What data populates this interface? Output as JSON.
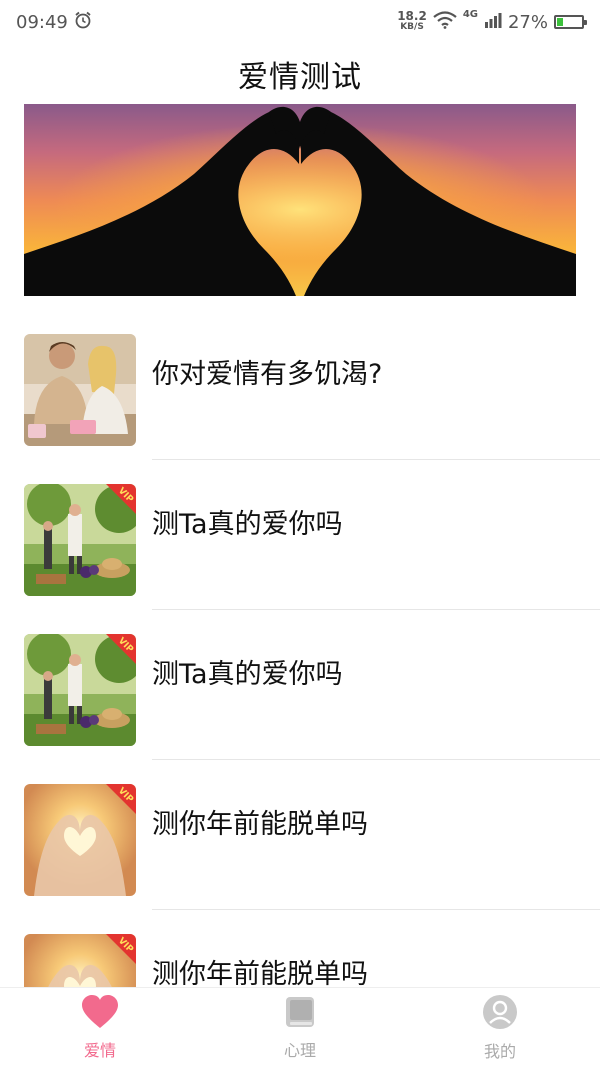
{
  "status_bar": {
    "time": "09:49",
    "alarm_icon": "alarm-icon",
    "net_speed": "18.2",
    "net_unit": "KB/S",
    "wifi_icon": "wifi-icon",
    "network_type": "4G",
    "signal_icon": "signal-icon",
    "battery_text": "27%",
    "battery_level": 0.27,
    "battery_color": "#3cc13c"
  },
  "header": {
    "title": "爱情测试"
  },
  "banner": {
    "icon": "heart-hands-image"
  },
  "list": {
    "items": [
      {
        "title": "你对爱情有多饥渴?",
        "vip": false,
        "thumb": "couple-photo"
      },
      {
        "title": "测Ta真的爱你吗",
        "vip": true,
        "thumb": "picnic-photo"
      },
      {
        "title": "测Ta真的爱你吗",
        "vip": true,
        "thumb": "picnic-photo"
      },
      {
        "title": "测你年前能脱单吗",
        "vip": true,
        "thumb": "heart-hands-photo"
      },
      {
        "title": "测你年前能脱单吗",
        "vip": true,
        "thumb": "heart-hands-photo"
      }
    ],
    "vip_label": "VIP"
  },
  "bottom_nav": {
    "items": [
      {
        "label": "爱情",
        "icon": "heart-icon",
        "active": true
      },
      {
        "label": "心理",
        "icon": "book-icon",
        "active": false
      },
      {
        "label": "我的",
        "icon": "user-icon",
        "active": false
      }
    ],
    "active_color": "#f26a8d",
    "inactive_color": "#aaaaaa"
  }
}
